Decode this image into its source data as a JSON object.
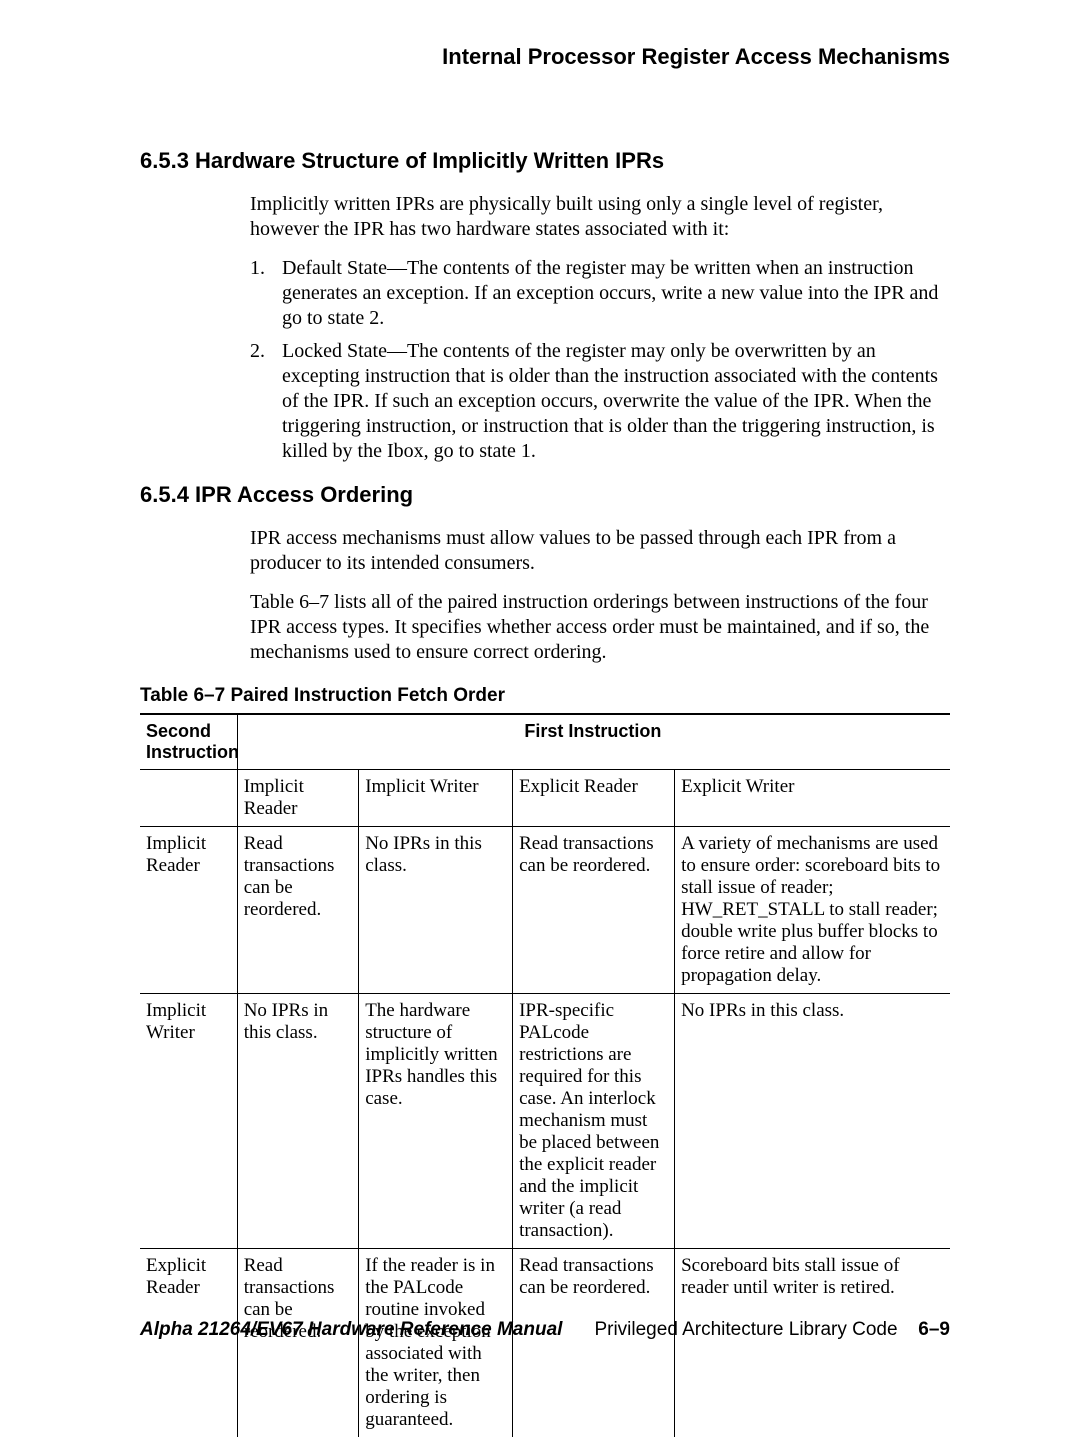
{
  "running_head": "Internal Processor Register Access Mechanisms",
  "section_653": {
    "heading": "6.5.3  Hardware Structure of Implicitly Written IPRs",
    "intro": "Implicitly written IPRs are physically built using only a single level of register, however the IPR has two hardware states associated with it:",
    "items": [
      {
        "num": "1.",
        "text": "Default State—The contents of the register may be written when an instruction generates an exception. If an exception occurs, write a new value into the IPR and go to state 2."
      },
      {
        "num": "2.",
        "text": "Locked State—The contents of the register may only be overwritten by an excepting instruction that is older than the instruction associated with the contents of the IPR. If such an exception occurs, overwrite the value of the IPR. When the triggering instruction, or instruction that is older than the triggering instruction, is killed by the Ibox, go to state 1."
      }
    ]
  },
  "section_654": {
    "heading": "6.5.4  IPR Access Ordering",
    "p1": "IPR access mechanisms must allow values to be passed through each IPR from a producer to its intended consumers.",
    "p2": "Table 6–7 lists all of the paired instruction orderings between instructions of the four IPR access types. It specifies whether access order must be maintained, and if so, the mechanisms used to ensure correct ordering."
  },
  "table": {
    "caption": "Table 6–7  Paired Instruction Fetch Order",
    "corner": "Second Instruction",
    "span_header": "First Instruction",
    "col_headers": [
      "Implicit Reader",
      "Implicit Writer",
      "Explicit Reader",
      "Explicit Writer"
    ],
    "rows": [
      {
        "label": "Implicit Reader",
        "cells": [
          "Read transactions can be reordered.",
          "No IPRs in this class.",
          "Read transactions can be reordered.",
          "A variety of mechanisms are used to ensure order: scoreboard bits to stall issue of reader; HW_RET_STALL to stall reader;  double write plus buffer blocks to force retire and allow for propagation delay."
        ]
      },
      {
        "label": "Implicit Writer",
        "cells": [
          "No IPRs in this class.",
          "The hardware structure of implicitly written IPRs handles this case.",
          "IPR-specific PALcode restrictions are required for this case. An interlock mechanism must be placed between the explicit reader and the implicit writer (a read transaction).",
          "No IPRs in this class."
        ]
      },
      {
        "label": "Explicit Reader",
        "cells": [
          "Read transactions can be reordered.",
          "If the reader is in the PALcode routine invoked by the exception associated with the writer, then ordering is guaranteed.",
          "Read transactions can be reordered.",
          "Scoreboard bits stall issue of reader until writer is retired."
        ]
      }
    ]
  },
  "footer": {
    "manual": "Alpha 21264/EV67 Hardware Reference Manual",
    "section": "Privileged Architecture Library Code",
    "page": "6–9"
  }
}
